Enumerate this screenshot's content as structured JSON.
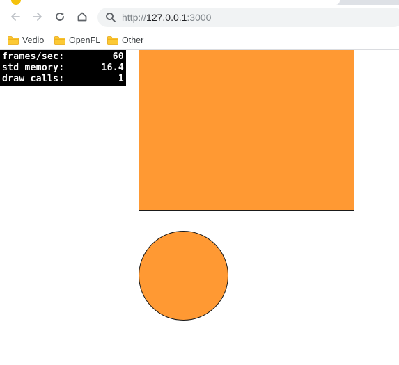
{
  "browser": {
    "url_scheme": "http://",
    "url_host": "127.0.0.1",
    "url_port": ":3000"
  },
  "icons": {
    "back": "arrow-left-icon",
    "forward": "arrow-right-icon",
    "reload": "reload-icon",
    "home": "home-icon",
    "search": "search-icon",
    "folder": "folder-icon"
  },
  "bookmarks": [
    {
      "label": "Vedio"
    },
    {
      "label": "OpenFL"
    },
    {
      "label": "Other"
    }
  ],
  "stats": [
    {
      "label": "frames/sec:",
      "value": "60"
    },
    {
      "label": "std memory:",
      "value": "16.4"
    },
    {
      "label": "draw calls:",
      "value": "1"
    }
  ],
  "colors": {
    "shape_fill": "#ff9933",
    "shape_stroke": "#1a1a1a",
    "stats_bg": "#000000",
    "stats_text": "#ffffff"
  }
}
